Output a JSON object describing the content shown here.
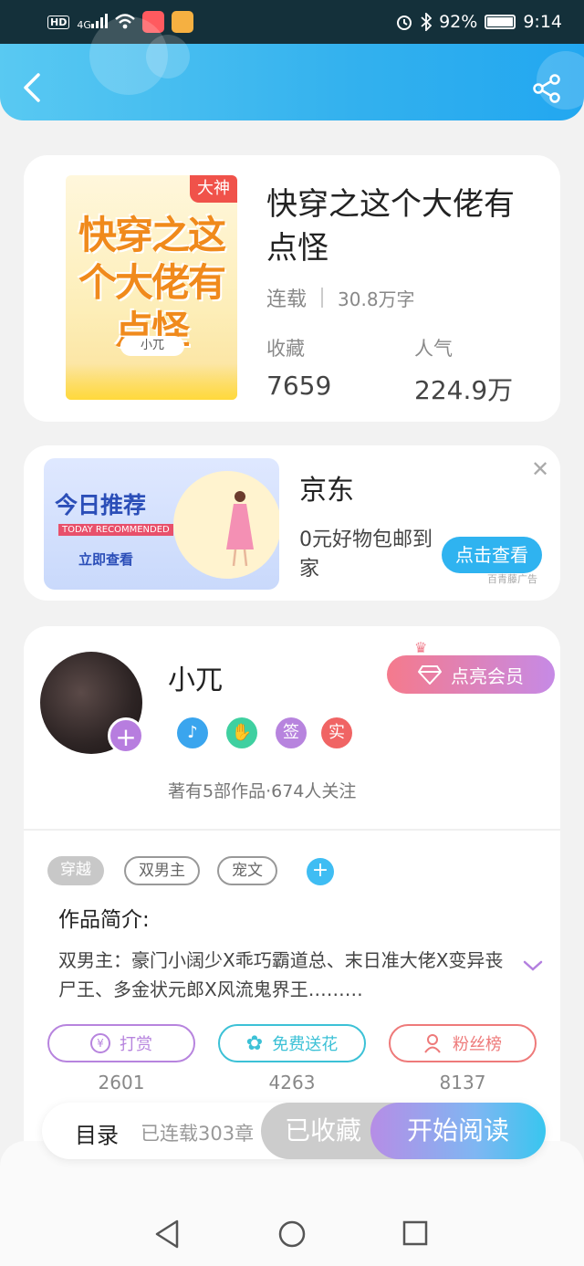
{
  "status_bar": {
    "hd": "HD",
    "signal": "4G",
    "battery_pct": "92%",
    "battery_level": 0.92,
    "time": "9:14"
  },
  "header": {
    "back_icon": "chevron-left-icon",
    "share_icon": "share-icon"
  },
  "book": {
    "badge": "大神",
    "cover_title": "快穿之这个大佬有点怪",
    "cover_author": "小兀",
    "title": "快穿之这个大佬有点怪",
    "status": "连载",
    "word_count": "30.8万字",
    "favorites_label": "收藏",
    "favorites_value": "7659",
    "popularity_label": "人气",
    "popularity_value": "224.9万"
  },
  "ad": {
    "banner_title": "今日推荐",
    "banner_subtitle": "TODAY RECOMMENDED",
    "banner_cta": "立即查看",
    "brand": "京东",
    "description": "0元好物包邮到家",
    "button": "点击查看",
    "source": "百青藤广告",
    "close_icon": "close-icon"
  },
  "author": {
    "name": "小兀",
    "vip_button": "点亮会员",
    "badges": [
      {
        "icon": "music-medal-icon",
        "color": "#3aa5ee"
      },
      {
        "icon": "handshake-medal-icon",
        "color": "#3fd0a0"
      },
      {
        "label": "签",
        "color": "#b784de"
      },
      {
        "label": "实",
        "color": "#f06464"
      }
    ],
    "stats": "著有5部作品·674人关注"
  },
  "tags": [
    "穿越",
    "双男主",
    "宠文"
  ],
  "intro": {
    "title": "作品简介:",
    "text": "双男主：豪门小阔少X乖巧霸道总、末日准大佬X变异丧尸王、多金状元郎X风流鬼界王………"
  },
  "actions": [
    {
      "label": "打赏",
      "count": "2601",
      "color": "#b784de",
      "icon": "yen-coin-icon"
    },
    {
      "label": "免费送花",
      "count": "4263",
      "color": "#3cc1d6",
      "icon": "flower-icon"
    },
    {
      "label": "粉丝榜",
      "count": "8137",
      "color": "#ee7a7a",
      "icon": "user-rank-icon"
    }
  ],
  "read_bar": {
    "toc": "目录",
    "toc_sub": "已连载303章",
    "fav_button": "已收藏",
    "read_button": "开始阅读"
  },
  "colors": {
    "header_blue": "#33b1ee",
    "accent_purple": "#b784de",
    "vip_pink": "#f57a8c"
  }
}
